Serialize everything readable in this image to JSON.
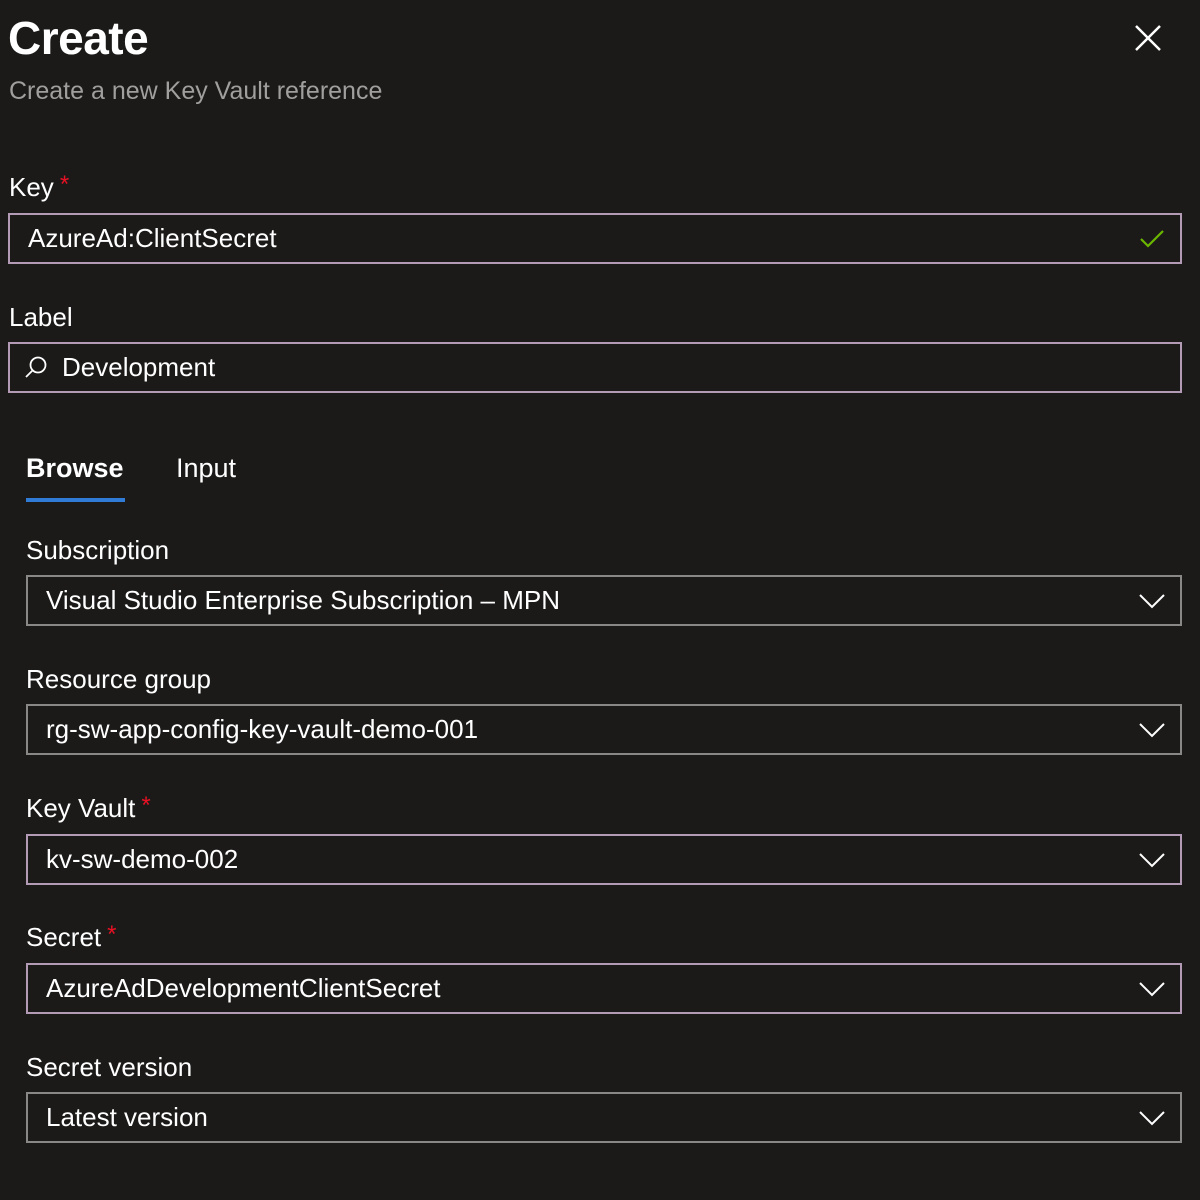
{
  "header": {
    "title": "Create",
    "subtitle": "Create a new Key Vault reference"
  },
  "icons": {
    "close": "close-icon",
    "check": "checkmark-icon",
    "search": "search-icon",
    "chevron": "chevron-down-icon"
  },
  "colors": {
    "background": "#1b1a19",
    "required": "#e81123",
    "focus_border": "#b39ab5",
    "tab_accent": "#2f7bd6",
    "valid_check": "#6bb700"
  },
  "key": {
    "label": "Key",
    "required_mark": "*",
    "value": "AzureAd:ClientSecret"
  },
  "label_field": {
    "label": "Label",
    "value": "Development"
  },
  "tabs": [
    {
      "label": "Browse",
      "active": true
    },
    {
      "label": "Input",
      "active": false
    }
  ],
  "subscription": {
    "label": "Subscription",
    "value": "Visual Studio Enterprise Subscription – MPN"
  },
  "resource_group": {
    "label": "Resource group",
    "value": "rg-sw-app-config-key-vault-demo-001"
  },
  "key_vault": {
    "label": "Key Vault",
    "required_mark": "*",
    "value": "kv-sw-demo-002"
  },
  "secret": {
    "label": "Secret",
    "required_mark": "*",
    "value": "AzureAdDevelopmentClientSecret"
  },
  "secret_version": {
    "label": "Secret version",
    "value": "Latest version"
  }
}
